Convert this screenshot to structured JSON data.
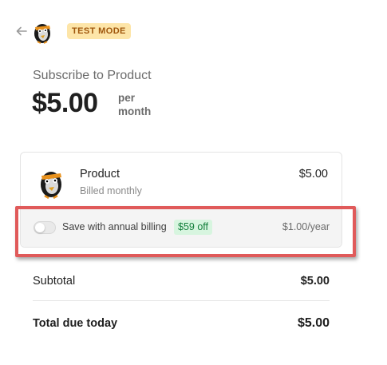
{
  "header": {
    "badge": "TEST MODE",
    "icons": {
      "back": "arrow-left-icon",
      "logo": "penguin-logo"
    }
  },
  "summary": {
    "title": "Subscribe to Product",
    "amount": "$5.00",
    "period_line1": "per",
    "period_line2": "month"
  },
  "line_item": {
    "name": "Product",
    "billing": "Billed monthly",
    "price": "$5.00"
  },
  "upsell": {
    "label": "Save with annual billing",
    "badge": "$59 off",
    "price": "$1.00/year",
    "toggle_on": false
  },
  "totals": {
    "subtotal_label": "Subtotal",
    "subtotal_value": "$5.00",
    "total_label": "Total due today",
    "total_value": "$5.00"
  },
  "colors": {
    "badge_bg": "#fde5a8",
    "badge_text": "#a0570d",
    "savings_bg": "#d7f5df",
    "savings_text": "#15803d",
    "highlight": "#e05a5a"
  }
}
